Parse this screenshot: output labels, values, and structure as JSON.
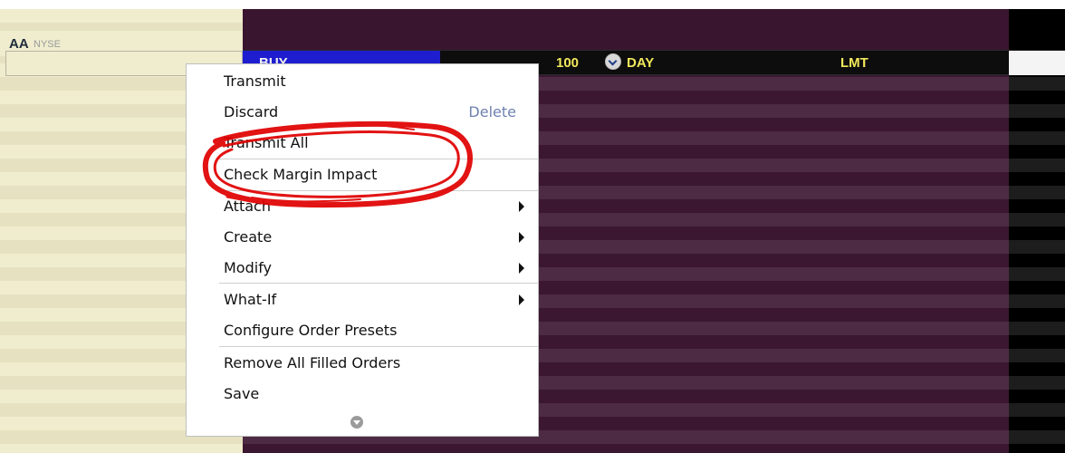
{
  "ticker": {
    "symbol": "AA",
    "exchange": "NYSE"
  },
  "order": {
    "action": "BUY",
    "quantity": "100",
    "time_in_force": "DAY",
    "type": "LMT"
  },
  "context_menu": {
    "items": [
      {
        "label": "Transmit",
        "shortcut": "",
        "has_submenu": false
      },
      {
        "label": "Discard",
        "shortcut": "Delete",
        "has_submenu": false
      },
      {
        "label": "Transmit All",
        "shortcut": "",
        "has_submenu": false
      },
      {
        "label": "Check Margin Impact",
        "shortcut": "",
        "has_submenu": false
      },
      {
        "label": "Attach",
        "shortcut": "",
        "has_submenu": true
      },
      {
        "label": "Create",
        "shortcut": "",
        "has_submenu": true
      },
      {
        "label": "Modify",
        "shortcut": "",
        "has_submenu": true
      },
      {
        "label": "What-If",
        "shortcut": "",
        "has_submenu": true
      },
      {
        "label": "Configure Order Presets",
        "shortcut": "",
        "has_submenu": false
      },
      {
        "label": "Remove All Filled Orders",
        "shortcut": "",
        "has_submenu": false
      },
      {
        "label": "Save",
        "shortcut": "",
        "has_submenu": false
      }
    ]
  },
  "colors": {
    "left_pane": "#efedce",
    "main_grid": "#3b1731",
    "right_pane": "#000000",
    "action_highlight": "#1e1ed0",
    "order_text": "#f2e95b",
    "menu_shortcut": "#6e81af",
    "annotation_red": "#e00000"
  },
  "icons": {
    "time_in_force": "clock-icon",
    "submenu": "chevron-right-icon",
    "scroll_down": "scroll-down-icon"
  }
}
